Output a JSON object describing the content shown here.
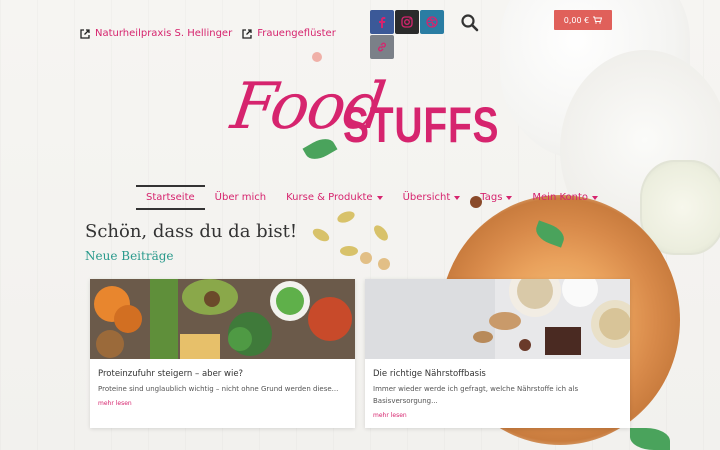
{
  "top_links": [
    {
      "label": "Naturheilpraxis S. Hellinger",
      "icon": "external-link-icon"
    },
    {
      "label": "Frauengeflüster",
      "icon": "external-link-icon"
    }
  ],
  "social": [
    {
      "name": "facebook",
      "icon": "facebook-icon",
      "glyph": "f",
      "color": "#3b5998"
    },
    {
      "name": "instagram",
      "icon": "instagram-icon",
      "glyph": "◎",
      "color": "#2b2b2b"
    },
    {
      "name": "dribbble",
      "icon": "dribbble-icon",
      "glyph": "◍",
      "color": "#2a7da3"
    },
    {
      "name": "link",
      "icon": "link-icon",
      "glyph": "∞",
      "color": "#7b8088"
    }
  ],
  "cart": {
    "label": "0,00 €",
    "icon": "cart-icon"
  },
  "logo": {
    "script": "Food",
    "bold": "STUFFS"
  },
  "nav": [
    {
      "label": "Startseite",
      "active": true,
      "dropdown": false
    },
    {
      "label": "Über mich",
      "active": false,
      "dropdown": false
    },
    {
      "label": "Kurse & Produkte",
      "active": false,
      "dropdown": true
    },
    {
      "label": "Übersicht",
      "active": false,
      "dropdown": true
    },
    {
      "label": "Tags",
      "active": false,
      "dropdown": true
    },
    {
      "label": "Mein Konto",
      "active": false,
      "dropdown": true
    }
  ],
  "welcome": "Schön, dass du da bist!",
  "section_title": "Neue Beiträge",
  "posts": [
    {
      "title": "Proteinzufuhr steigern – aber wie?",
      "excerpt": "Proteine sind unglaublich wichtig – nicht ohne Grund werden diese...",
      "more": "mehr lesen"
    },
    {
      "title": "Die richtige Nährstoffbasis",
      "excerpt": "Immer wieder werde ich gefragt, welche Nährstoffe ich als Basisversorgung...",
      "more": "mehr lesen"
    }
  ],
  "colors": {
    "brand": "#d6246e",
    "teal": "#2a9a8c",
    "cart": "#e0605a"
  }
}
